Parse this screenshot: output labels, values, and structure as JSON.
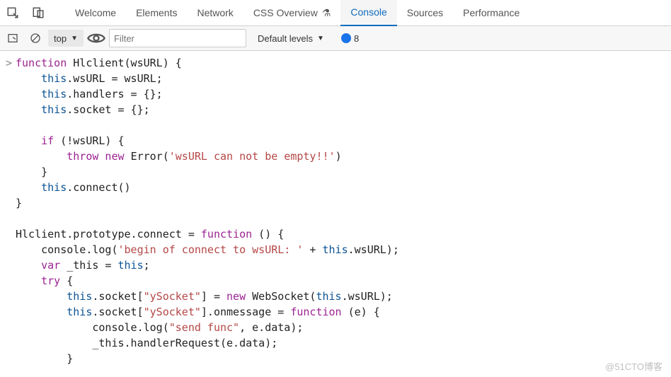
{
  "tabs": {
    "items": [
      {
        "label": "Welcome"
      },
      {
        "label": "Elements"
      },
      {
        "label": "Network"
      },
      {
        "label": "CSS Overview",
        "warn": true
      },
      {
        "label": "Console",
        "active": true
      },
      {
        "label": "Sources"
      },
      {
        "label": "Performance"
      }
    ]
  },
  "toolbar": {
    "context": "top",
    "filter_placeholder": "Filter",
    "levels_label": "Default levels",
    "error_count": "8"
  },
  "code": {
    "lines": [
      {
        "g": ">",
        "seg": [
          {
            "t": "function ",
            "c": "kw"
          },
          {
            "t": "Hlclient(wsURL) {",
            "c": "fn-name"
          }
        ]
      },
      {
        "g": " ",
        "seg": [
          {
            "t": "    "
          },
          {
            "t": "this",
            "c": "obj"
          },
          {
            "t": ".wsURL = wsURL;",
            "c": "prop"
          }
        ]
      },
      {
        "g": " ",
        "seg": [
          {
            "t": "    "
          },
          {
            "t": "this",
            "c": "obj"
          },
          {
            "t": ".handlers = {};",
            "c": "prop"
          }
        ]
      },
      {
        "g": " ",
        "seg": [
          {
            "t": "    "
          },
          {
            "t": "this",
            "c": "obj"
          },
          {
            "t": ".socket = {};",
            "c": "prop"
          }
        ]
      },
      {
        "g": " ",
        "seg": [
          {
            "t": " "
          }
        ]
      },
      {
        "g": " ",
        "seg": [
          {
            "t": "    "
          },
          {
            "t": "if",
            "c": "kw"
          },
          {
            "t": " (!wsURL) {"
          }
        ]
      },
      {
        "g": " ",
        "seg": [
          {
            "t": "        "
          },
          {
            "t": "throw new ",
            "c": "kw"
          },
          {
            "t": "Error("
          },
          {
            "t": "'wsURL can not be empty!!'",
            "c": "str"
          },
          {
            "t": ")"
          }
        ]
      },
      {
        "g": " ",
        "seg": [
          {
            "t": "    }"
          }
        ]
      },
      {
        "g": " ",
        "seg": [
          {
            "t": "    "
          },
          {
            "t": "this",
            "c": "obj"
          },
          {
            "t": ".connect()",
            "c": "prop"
          }
        ]
      },
      {
        "g": " ",
        "seg": [
          {
            "t": "}"
          }
        ]
      },
      {
        "g": " ",
        "seg": [
          {
            "t": " "
          }
        ]
      },
      {
        "g": " ",
        "seg": [
          {
            "t": "Hlclient.prototype.connect = "
          },
          {
            "t": "function",
            "c": "kw"
          },
          {
            "t": " () {"
          }
        ]
      },
      {
        "g": " ",
        "seg": [
          {
            "t": "    console.log("
          },
          {
            "t": "'begin of connect to wsURL: '",
            "c": "str"
          },
          {
            "t": " + "
          },
          {
            "t": "this",
            "c": "obj"
          },
          {
            "t": ".wsURL);",
            "c": "prop"
          }
        ]
      },
      {
        "g": " ",
        "seg": [
          {
            "t": "    "
          },
          {
            "t": "var",
            "c": "kw"
          },
          {
            "t": " _this = "
          },
          {
            "t": "this",
            "c": "obj"
          },
          {
            "t": ";"
          }
        ]
      },
      {
        "g": " ",
        "seg": [
          {
            "t": "    "
          },
          {
            "t": "try",
            "c": "kw"
          },
          {
            "t": " {"
          }
        ]
      },
      {
        "g": " ",
        "seg": [
          {
            "t": "        "
          },
          {
            "t": "this",
            "c": "obj"
          },
          {
            "t": ".socket[",
            "c": "prop"
          },
          {
            "t": "\"ySocket\"",
            "c": "str"
          },
          {
            "t": "] = "
          },
          {
            "t": "new",
            "c": "kw"
          },
          {
            "t": " WebSocket("
          },
          {
            "t": "this",
            "c": "obj"
          },
          {
            "t": ".wsURL);",
            "c": "prop"
          }
        ]
      },
      {
        "g": " ",
        "seg": [
          {
            "t": "        "
          },
          {
            "t": "this",
            "c": "obj"
          },
          {
            "t": ".socket[",
            "c": "prop"
          },
          {
            "t": "\"ySocket\"",
            "c": "str"
          },
          {
            "t": "].onmessage = "
          },
          {
            "t": "function",
            "c": "kw"
          },
          {
            "t": " (e) {"
          }
        ]
      },
      {
        "g": " ",
        "seg": [
          {
            "t": "            console.log("
          },
          {
            "t": "\"send func\"",
            "c": "str"
          },
          {
            "t": ", e.data);"
          }
        ]
      },
      {
        "g": " ",
        "seg": [
          {
            "t": "            _this.handlerRequest(e.data);"
          }
        ]
      },
      {
        "g": " ",
        "seg": [
          {
            "t": "        }"
          }
        ]
      }
    ]
  },
  "watermark": "@51CTO博客"
}
